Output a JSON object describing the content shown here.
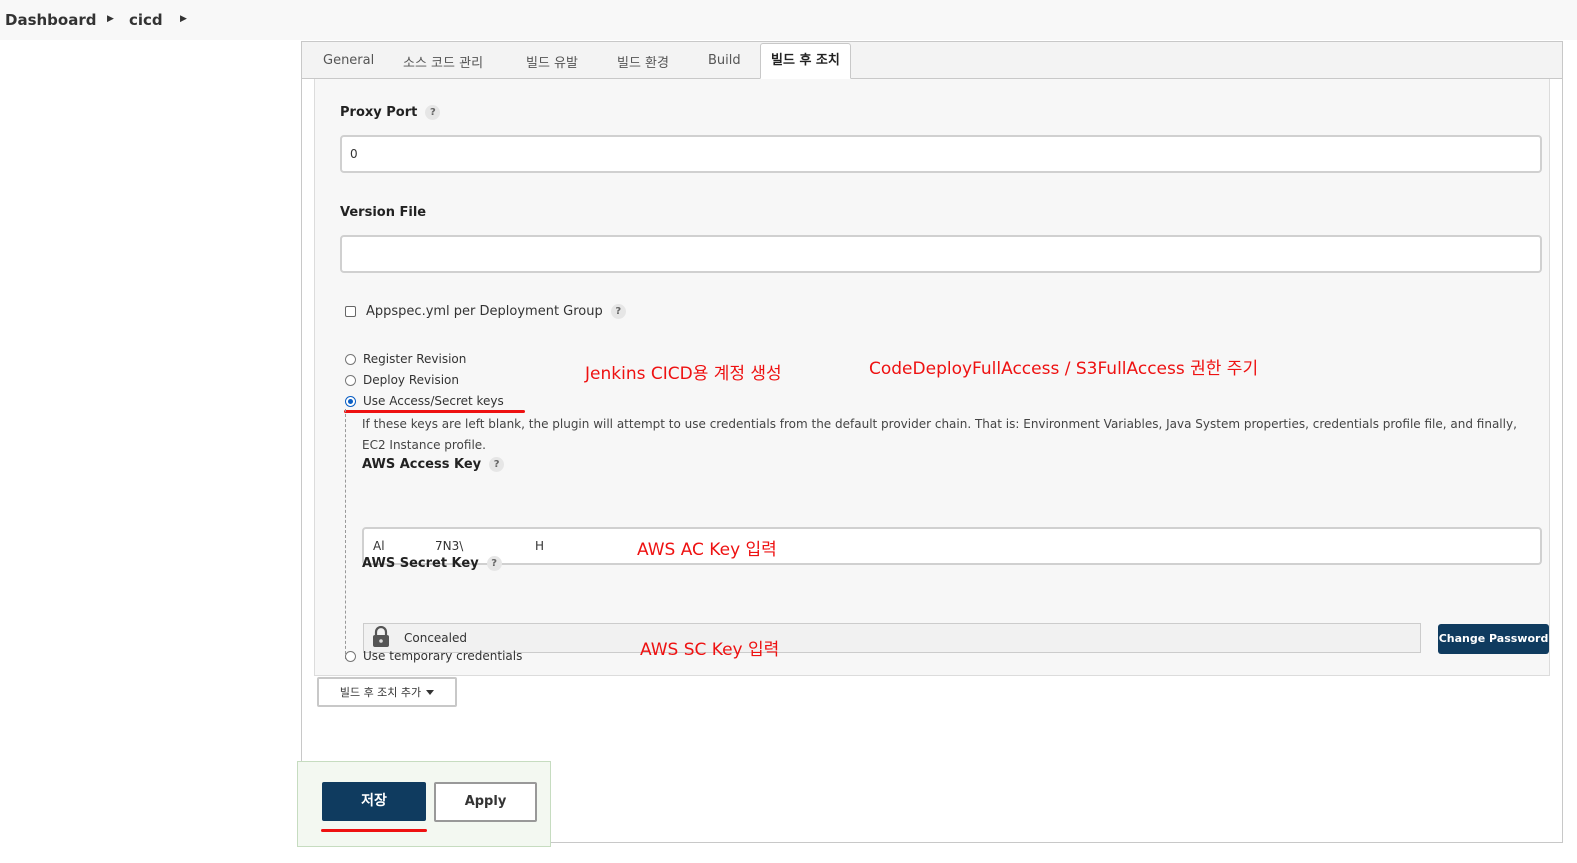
{
  "breadcrumb": {
    "home": "Dashboard",
    "job": "cicd"
  },
  "tabs": [
    "General",
    "소스 코드 관리",
    "빌드 유발",
    "빌드 환경",
    "Build",
    "빌드 후 조치"
  ],
  "form": {
    "proxy_port": {
      "label": "Proxy Port",
      "value": "0"
    },
    "version_file": {
      "label": "Version File",
      "value": ""
    },
    "appspec": {
      "label": "Appspec.yml per Deployment Group",
      "checked": false
    },
    "radios": {
      "register": "Register Revision",
      "deploy": "Deploy Revision",
      "access": "Use Access/Secret keys",
      "temporary": "Use temporary credentials",
      "selected": "Use Access/Secret keys"
    },
    "access_keys_help": "If these keys are left blank, the plugin will attempt to use credentials from the default provider chain. That is: Environment Variables, Java System properties, credentials profile file, and finally, EC2 Instance profile.",
    "access_key": {
      "label": "AWS Access Key",
      "v1": "Al",
      "v2": "7N3\\",
      "v3": "H"
    },
    "secret_key": {
      "label": "AWS Secret Key",
      "concealed": "Concealed",
      "change_button": "Change Password"
    },
    "help_icon": "?"
  },
  "annotations": {
    "account": "Jenkins CICD용 계정 생성",
    "permission": "CodeDeployFullAccess / S3FullAccess 권한 주기",
    "ac_key": "AWS AC Key 입력",
    "sc_key": "AWS SC Key 입력"
  },
  "buttons": {
    "add_post_build": "빌드 후 조치 추가",
    "save": "저장",
    "apply": "Apply"
  },
  "colors": {
    "annotation": "#ee1111",
    "primary": "#0f3b5f",
    "radio": "#0a5ec4"
  },
  "icons": [
    "chevron-right-icon",
    "help-icon",
    "lock-icon",
    "caret-down-icon"
  ]
}
